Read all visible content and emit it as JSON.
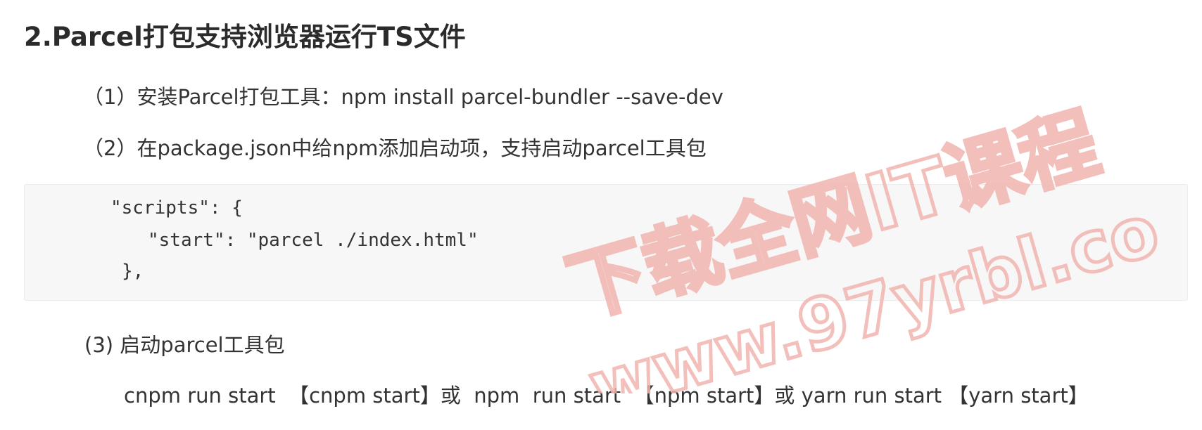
{
  "heading": "2.Parcel打包支持浏览器运行TS文件",
  "steps": [
    {
      "text": "（1）安装Parcel打包工具：npm install parcel-bundler --save-dev"
    },
    {
      "text": "（2）在package.json中给npm添加启动项，支持启动parcel工具包"
    },
    {
      "text": "(3)  启动parcel工具包"
    }
  ],
  "code": {
    "lines": [
      "\"scripts\": {",
      "\"start\": \"parcel ./index.html\"",
      "},"
    ]
  },
  "commands": "cnpm run start  【cnpm start】或  npm  run start  【npm start】或 yarn run start 【yarn start】",
  "watermark": {
    "line1": "下载全网IT课程",
    "line2": "www.97yrbl.co",
    "color": "#f2b5b0"
  }
}
